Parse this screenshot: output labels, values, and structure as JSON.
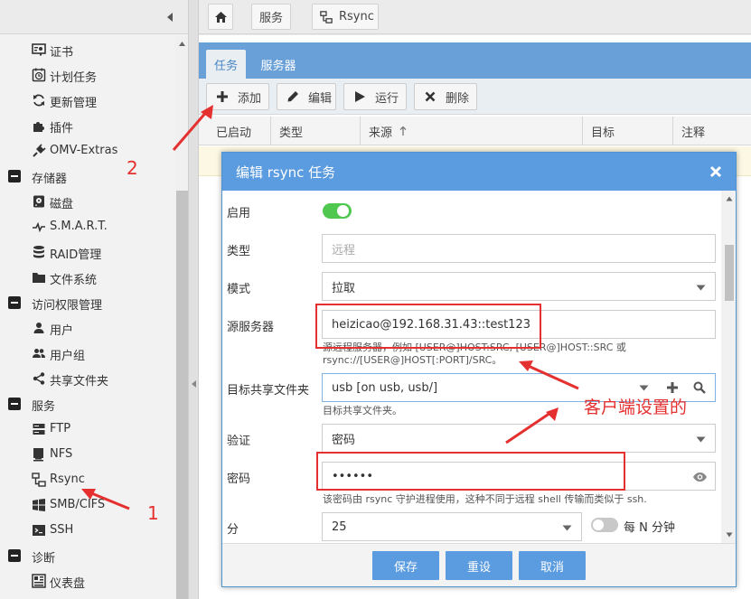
{
  "sidebar": {
    "items": [
      {
        "label": "证书",
        "icon": "certificate-icon",
        "group": false
      },
      {
        "label": "计划任务",
        "icon": "clock-icon",
        "group": false
      },
      {
        "label": "更新管理",
        "icon": "refresh-icon",
        "group": false
      },
      {
        "label": "插件",
        "icon": "puzzle-icon",
        "group": false
      },
      {
        "label": "OMV-Extras",
        "icon": "plug-icon",
        "group": false
      },
      {
        "label": "存储器",
        "icon": "minus-square-icon",
        "group": true
      },
      {
        "label": "磁盘",
        "icon": "hard-disk-icon",
        "group": false
      },
      {
        "label": "S.M.A.R.T.",
        "icon": "heartbeat-icon",
        "group": false
      },
      {
        "label": "RAID管理",
        "icon": "database-icon",
        "group": false
      },
      {
        "label": "文件系统",
        "icon": "folder-icon",
        "group": false
      },
      {
        "label": "访问权限管理",
        "icon": "minus-square-icon",
        "group": true
      },
      {
        "label": "用户",
        "icon": "user-icon",
        "group": false
      },
      {
        "label": "用户组",
        "icon": "users-icon",
        "group": false
      },
      {
        "label": "共享文件夹",
        "icon": "share-icon",
        "group": false
      },
      {
        "label": "服务",
        "icon": "minus-square-icon",
        "group": true
      },
      {
        "label": "FTP",
        "icon": "server-icon",
        "group": false
      },
      {
        "label": "NFS",
        "icon": "desktop-icon",
        "group": false
      },
      {
        "label": "Rsync",
        "icon": "network-icon",
        "group": false
      },
      {
        "label": "SMB/CIFS",
        "icon": "windows-icon",
        "group": false
      },
      {
        "label": "SSH",
        "icon": "terminal-icon",
        "group": false
      },
      {
        "label": "诊断",
        "icon": "minus-square-icon",
        "group": true
      },
      {
        "label": "仪表盘",
        "icon": "dashboard-icon",
        "group": false
      }
    ]
  },
  "breadcrumb": {
    "services": "服务",
    "rsync": "Rsync"
  },
  "tabs": {
    "tasks": "任务",
    "servers": "服务器"
  },
  "toolbar": {
    "add": "添加",
    "edit": "编辑",
    "run": "运行",
    "delete": "删除"
  },
  "grid": {
    "columns": {
      "enabled": "已启动",
      "type": "类型",
      "source": "来源",
      "target": "目标",
      "comment": "注释"
    }
  },
  "modal": {
    "title": "编辑 rsync 任务",
    "enabled_label": "启用",
    "enabled": true,
    "type_label": "类型",
    "type_placeholder": "远程",
    "mode_label": "模式",
    "mode_value": "拉取",
    "source_server_label": "源服务器",
    "source_server_value": "heizicao@192.168.31.43::test123",
    "source_hint_1": "源远程服务器，例如 [USER@]HOST:SRC, [USER@]HOST::SRC 或",
    "source_hint_2": "rsync://[USER@]HOST[:PORT]/SRC。",
    "target_label": "目标共享文件夹",
    "target_value": "usb [on usb, usb/]",
    "target_hint": "目标共享文件夹。",
    "auth_label": "验证",
    "auth_value": "密码",
    "password_label": "密码",
    "password_value": "••••••",
    "password_hint": "该密码由 rsync 守护进程使用，这种不同于远程 shell 传输而类似于 ssh.",
    "minute_label": "分",
    "minute_value": "25",
    "every_n_minutes": "每 N 分钟",
    "every_n_enabled": false,
    "save": "保存",
    "reset": "重设",
    "cancel": "取消"
  },
  "annotations": {
    "step1": "1",
    "step2": "2",
    "client_setting": "客户端设置的"
  },
  "colors": {
    "accent": "#5b9bdf",
    "tabbar": "#6aa0d8",
    "toggle_on": "#50c850",
    "annotation_red": "#e53030"
  }
}
